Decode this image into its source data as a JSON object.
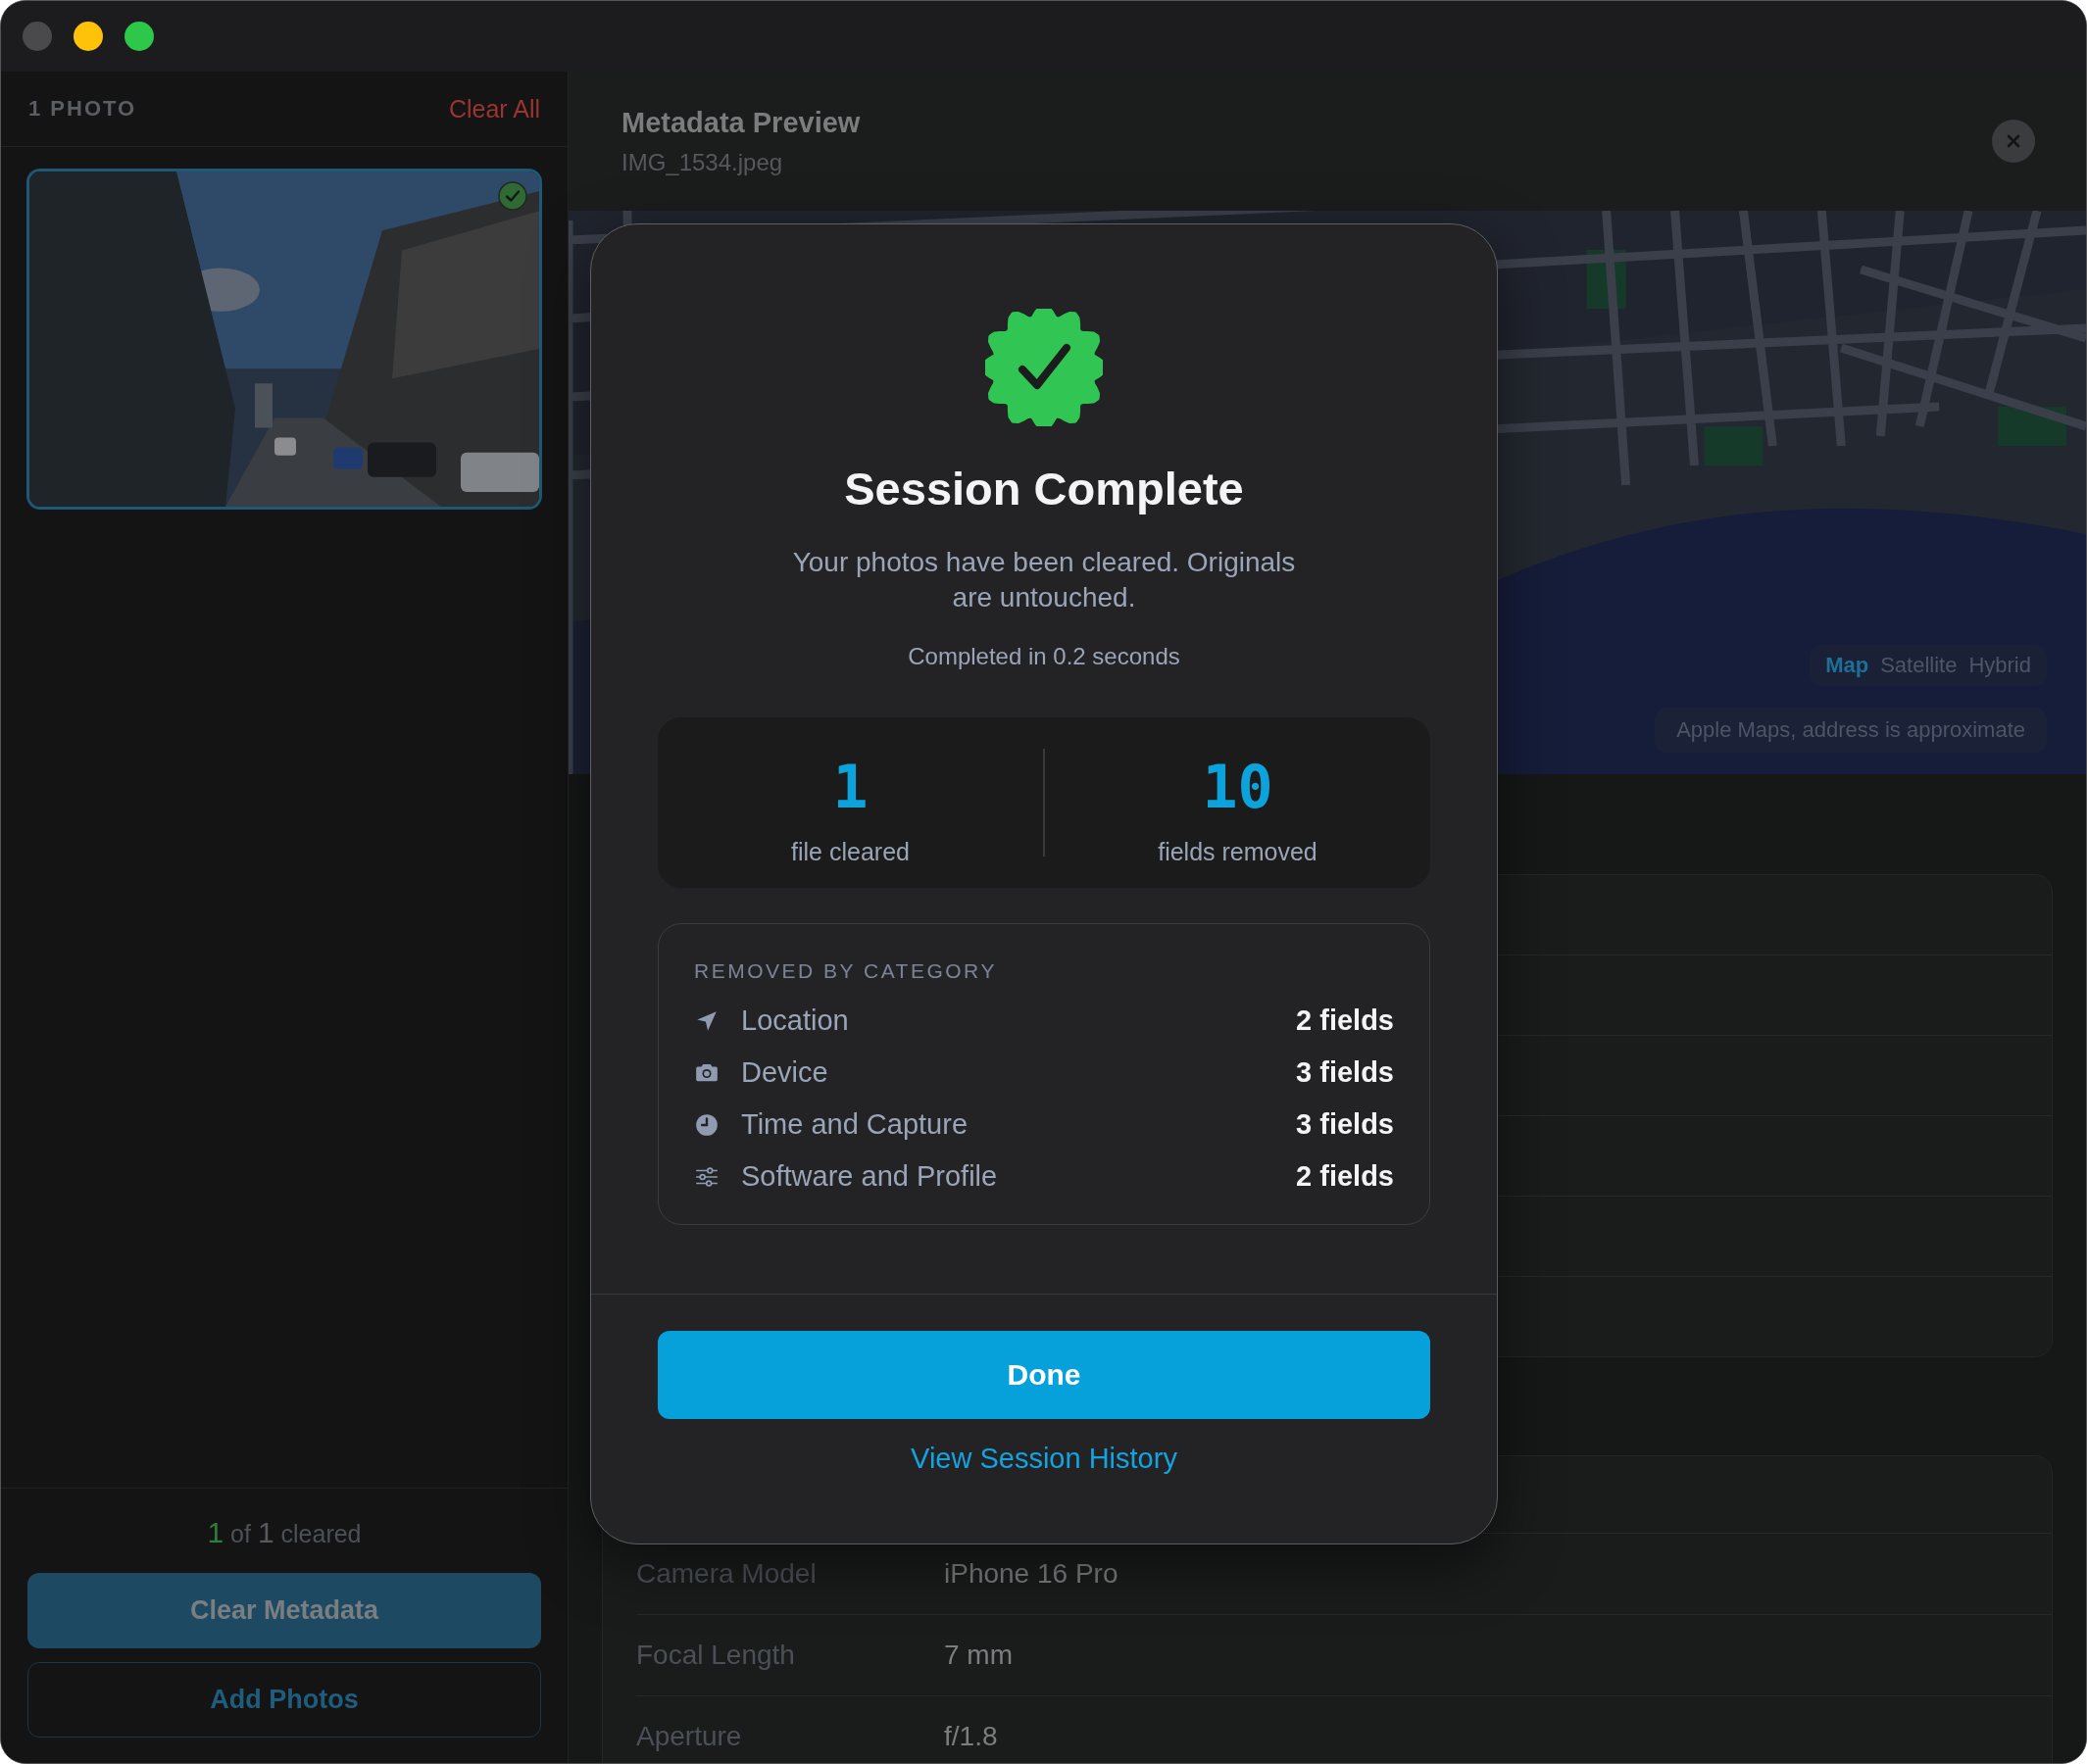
{
  "sidebar": {
    "count_label": "1 PHOTO",
    "clear_all": "Clear All",
    "photos": [
      {
        "kind": "picture",
        "cleared": true,
        "selected": true
      }
    ],
    "progress": {
      "done": "1",
      "of": "of",
      "total": "1",
      "label": "cleared"
    },
    "primary_button": "Clear Metadata",
    "secondary_button": "Add Photos"
  },
  "preview": {
    "title": "Metadata Preview",
    "filename": "IMG_1534.jpeg",
    "map": {
      "kind": "picture",
      "map_types": [
        {
          "label": "Map",
          "selected": true
        },
        {
          "label": "Satellite",
          "selected": false
        },
        {
          "label": "Hybrid",
          "selected": false
        }
      ],
      "attribution": "Apple Maps, address is approximate"
    },
    "device_rows": [
      {
        "label": "Camera Model",
        "value": "iPhone 16 Pro"
      },
      {
        "label": "Focal Length",
        "value": "7 mm"
      },
      {
        "label": "Aperture",
        "value": "f/1.8"
      }
    ]
  },
  "modal": {
    "title": "Session Complete",
    "message": "Your photos have been cleared. Originals are untouched.",
    "duration": "Completed in 0.2 seconds",
    "stats": [
      {
        "value": "1",
        "label": "file cleared"
      },
      {
        "value": "10",
        "label": "fields removed"
      }
    ],
    "categories_heading": "REMOVED BY CATEGORY",
    "categories": [
      {
        "kind": "location",
        "name": "Location",
        "count": "2 fields"
      },
      {
        "kind": "device",
        "name": "Device",
        "count": "3 fields"
      },
      {
        "kind": "time",
        "name": "Time and Capture",
        "count": "3 fields"
      },
      {
        "kind": "software",
        "name": "Software and Profile",
        "count": "2 fields"
      }
    ],
    "primary_button": "Done",
    "link": "View Session History"
  }
}
